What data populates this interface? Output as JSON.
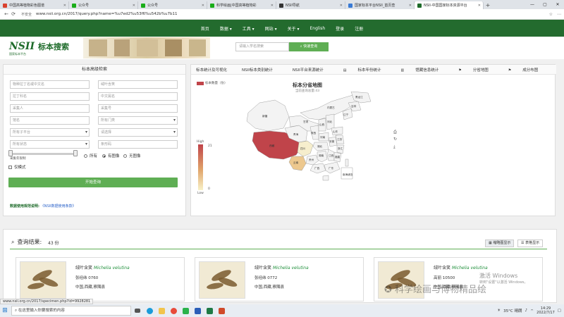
{
  "browser": {
    "tabs": [
      {
        "label": "中国高等植物彩色图谱",
        "color": "#d9422f",
        "active": false
      },
      {
        "label": "公众号",
        "color": "#1aad19",
        "active": false
      },
      {
        "label": "公众号",
        "color": "#1aad19",
        "active": false
      },
      {
        "label": "科学绘画|中国高等植物彩",
        "color": "#1aad19",
        "active": false
      },
      {
        "label": "NSII导航",
        "color": "#333333",
        "active": false
      },
      {
        "label": "国家标本平台NSII_首页查",
        "color": "#3a7bd5",
        "active": false
      },
      {
        "label": "NSII-中国国家标本资源平台",
        "color": "#1e6b2a",
        "active": true
      }
    ],
    "new_tab": "+",
    "insecure_label": "不安全",
    "url": "www.nsii.org.cn/2017/query.php?name=%u7ed2%u53f6%u542b%u7b11"
  },
  "site_nav": [
    "首页",
    "数据 ▾",
    "工具 ▾",
    "网站 ▾",
    "关于 ▾",
    "English",
    "登录",
    "注册"
  ],
  "banner": {
    "logo_mark": "NSII",
    "logo_sub": "国家标本平台",
    "title": "标本搜索",
    "search_placeholder": "请输入学名搜索",
    "search_button": "快速查询"
  },
  "advanced": {
    "title": "标本高级检索",
    "fields": [
      {
        "text": "物种拉丁名或中文名",
        "select": false
      },
      {
        "text": "绒叶含笑",
        "select": false
      },
      {
        "text": "拉丁科名",
        "select": false
      },
      {
        "text": "中文属名",
        "select": false
      },
      {
        "text": "采集人",
        "select": false
      },
      {
        "text": "采集号",
        "select": false
      },
      {
        "text": "馆名",
        "select": false
      },
      {
        "text": "所有门类",
        "select": true
      },
      {
        "text": "所有子平台",
        "select": true
      },
      {
        "text": "请选择",
        "select": true
      },
      {
        "text": "所有状态",
        "select": true
      },
      {
        "text": "条形码",
        "select": false
      }
    ],
    "slider_label": "采集年限制",
    "radios": [
      {
        "label": "所有",
        "on": false
      },
      {
        "label": "有图像",
        "on": true
      },
      {
        "label": "无图像",
        "on": false
      }
    ],
    "checkbox_label": "仅模式",
    "query_button": "开始查询",
    "notice_label": "数据使用规范说明:",
    "notice_link": "《NSII数据使用条款》"
  },
  "stats": {
    "title": "标本统计及可视化",
    "tabs": [
      "NSII标本类别统计",
      "NSII平台来源统计",
      "标本年份统计",
      "馆藏信息统计",
      "分省地图",
      "成分布图"
    ],
    "legend_label": "标本数量（份）",
    "map_title": "标本分省地图",
    "map_subtitle": "当前查询总量:43",
    "visualmap": {
      "high": "High",
      "max": "21",
      "low": "Low",
      "min": "0"
    },
    "provinces": [
      "新疆",
      "西藏",
      "青海",
      "甘肃",
      "内蒙古",
      "四川",
      "云南",
      "贵州",
      "广西",
      "广东",
      "湖南",
      "湖北",
      "江西",
      "福建",
      "浙江",
      "安徽",
      "河南",
      "陕西",
      "山西",
      "河北",
      "北京",
      "天津",
      "山东",
      "江苏",
      "上海",
      "辽宁",
      "吉林",
      "黑龙江",
      "重庆",
      "宁夏",
      "海南",
      "台湾",
      "香港",
      "澳门",
      "南海诸岛"
    ]
  },
  "results": {
    "title": "查询结果:",
    "count": "43 份",
    "view_buttons": [
      "缩略图显示",
      "表格显示"
    ],
    "cards": [
      {
        "cn": "绒叶含笑",
        "latin": "Michelia velutina",
        "collector": "张经纬 0760",
        "place": "中国,西藏,察隅县"
      },
      {
        "cn": "绒叶含笑",
        "latin": "Michelia velutina",
        "collector": "张经纬 0772",
        "place": "中国,西藏,察隅县"
      },
      {
        "cn": "绒叶含笑",
        "latin": "Michelia velutina",
        "collector": "高丽 10500",
        "place": "中国,西藏,察隅县"
      }
    ]
  },
  "overlay": {
    "watermark": "科学绘画与博物精品绘",
    "activate_title": "激活 Windows",
    "activate_sub": "转到\"设置\"以激活 Windows。"
  },
  "status_url": "www.nsii.org.cn/2017/specimen.php?id=9928281",
  "taskbar": {
    "search": "在这里输入你要搜索的内容",
    "weather": "35°C 晴朗",
    "time": "14:29",
    "date": "2022/7/17"
  }
}
